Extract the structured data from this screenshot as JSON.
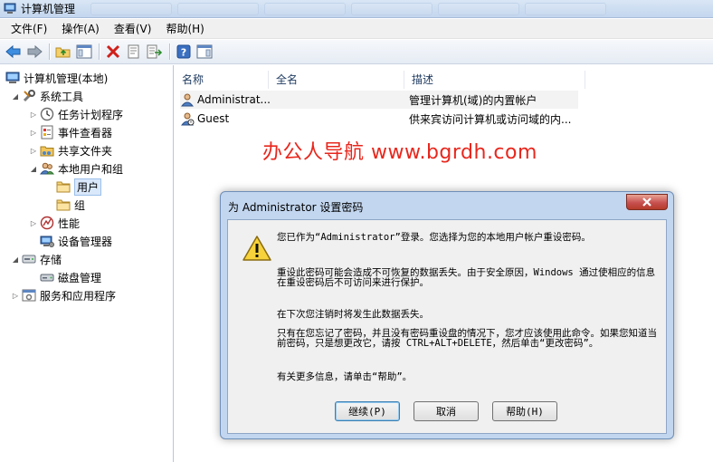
{
  "window": {
    "title": "计算机管理"
  },
  "menubar": {
    "items": [
      "文件(F)",
      "操作(A)",
      "查看(V)",
      "帮助(H)"
    ]
  },
  "tree": {
    "items": [
      {
        "label": "计算机管理(本地)",
        "icon": "computer-management-icon"
      },
      {
        "label": "系统工具",
        "icon": "tools-icon"
      },
      {
        "label": "任务计划程序",
        "icon": "clock-icon"
      },
      {
        "label": "事件查看器",
        "icon": "event-viewer-icon"
      },
      {
        "label": "共享文件夹",
        "icon": "shared-folder-icon"
      },
      {
        "label": "本地用户和组",
        "icon": "users-group-icon"
      },
      {
        "label": "用户",
        "icon": "folder-icon"
      },
      {
        "label": "组",
        "icon": "folder-icon"
      },
      {
        "label": "性能",
        "icon": "performance-icon"
      },
      {
        "label": "设备管理器",
        "icon": "device-manager-icon"
      },
      {
        "label": "存储",
        "icon": "storage-icon"
      },
      {
        "label": "磁盘管理",
        "icon": "disk-icon"
      },
      {
        "label": "服务和应用程序",
        "icon": "services-icon"
      }
    ]
  },
  "list": {
    "columns": [
      "名称",
      "全名",
      "描述"
    ],
    "rows": [
      {
        "name": "Administrat...",
        "fullname": "",
        "description": "管理计算机(域)的内置帐户"
      },
      {
        "name": "Guest",
        "fullname": "",
        "description": "供来宾访问计算机或访问域的内..."
      }
    ]
  },
  "watermark": "办公人导航 www.bgrdh.com",
  "dialog": {
    "title": "为 Administrator 设置密码",
    "message1": "您已作为“Administrator”登录。您选择为您的本地用户帐户重设密码。",
    "message2": "重设此密码可能会造成不可恢复的数据丢失。由于安全原因，Windows 通过使相应的信息在重设密码后不可访问来进行保护。",
    "message3": "在下次您注销时将发生此数据丢失。",
    "message4": "只有在您忘记了密码，并且没有密码重设盘的情况下，您才应该使用此命令。如果您知道当前密码，只是想更改它，请按 CTRL+ALT+DELETE，然后单击“更改密码”。",
    "message5": "有关更多信息，请单击“帮助”。",
    "buttons": {
      "continue": "继续(P)",
      "cancel": "取消",
      "help": "帮助(H)"
    }
  },
  "colors": {
    "selection": "#d9e8fb",
    "dialog_frame": "#c2d6ef",
    "close_button": "#c75050",
    "watermark": "#e8271d"
  }
}
